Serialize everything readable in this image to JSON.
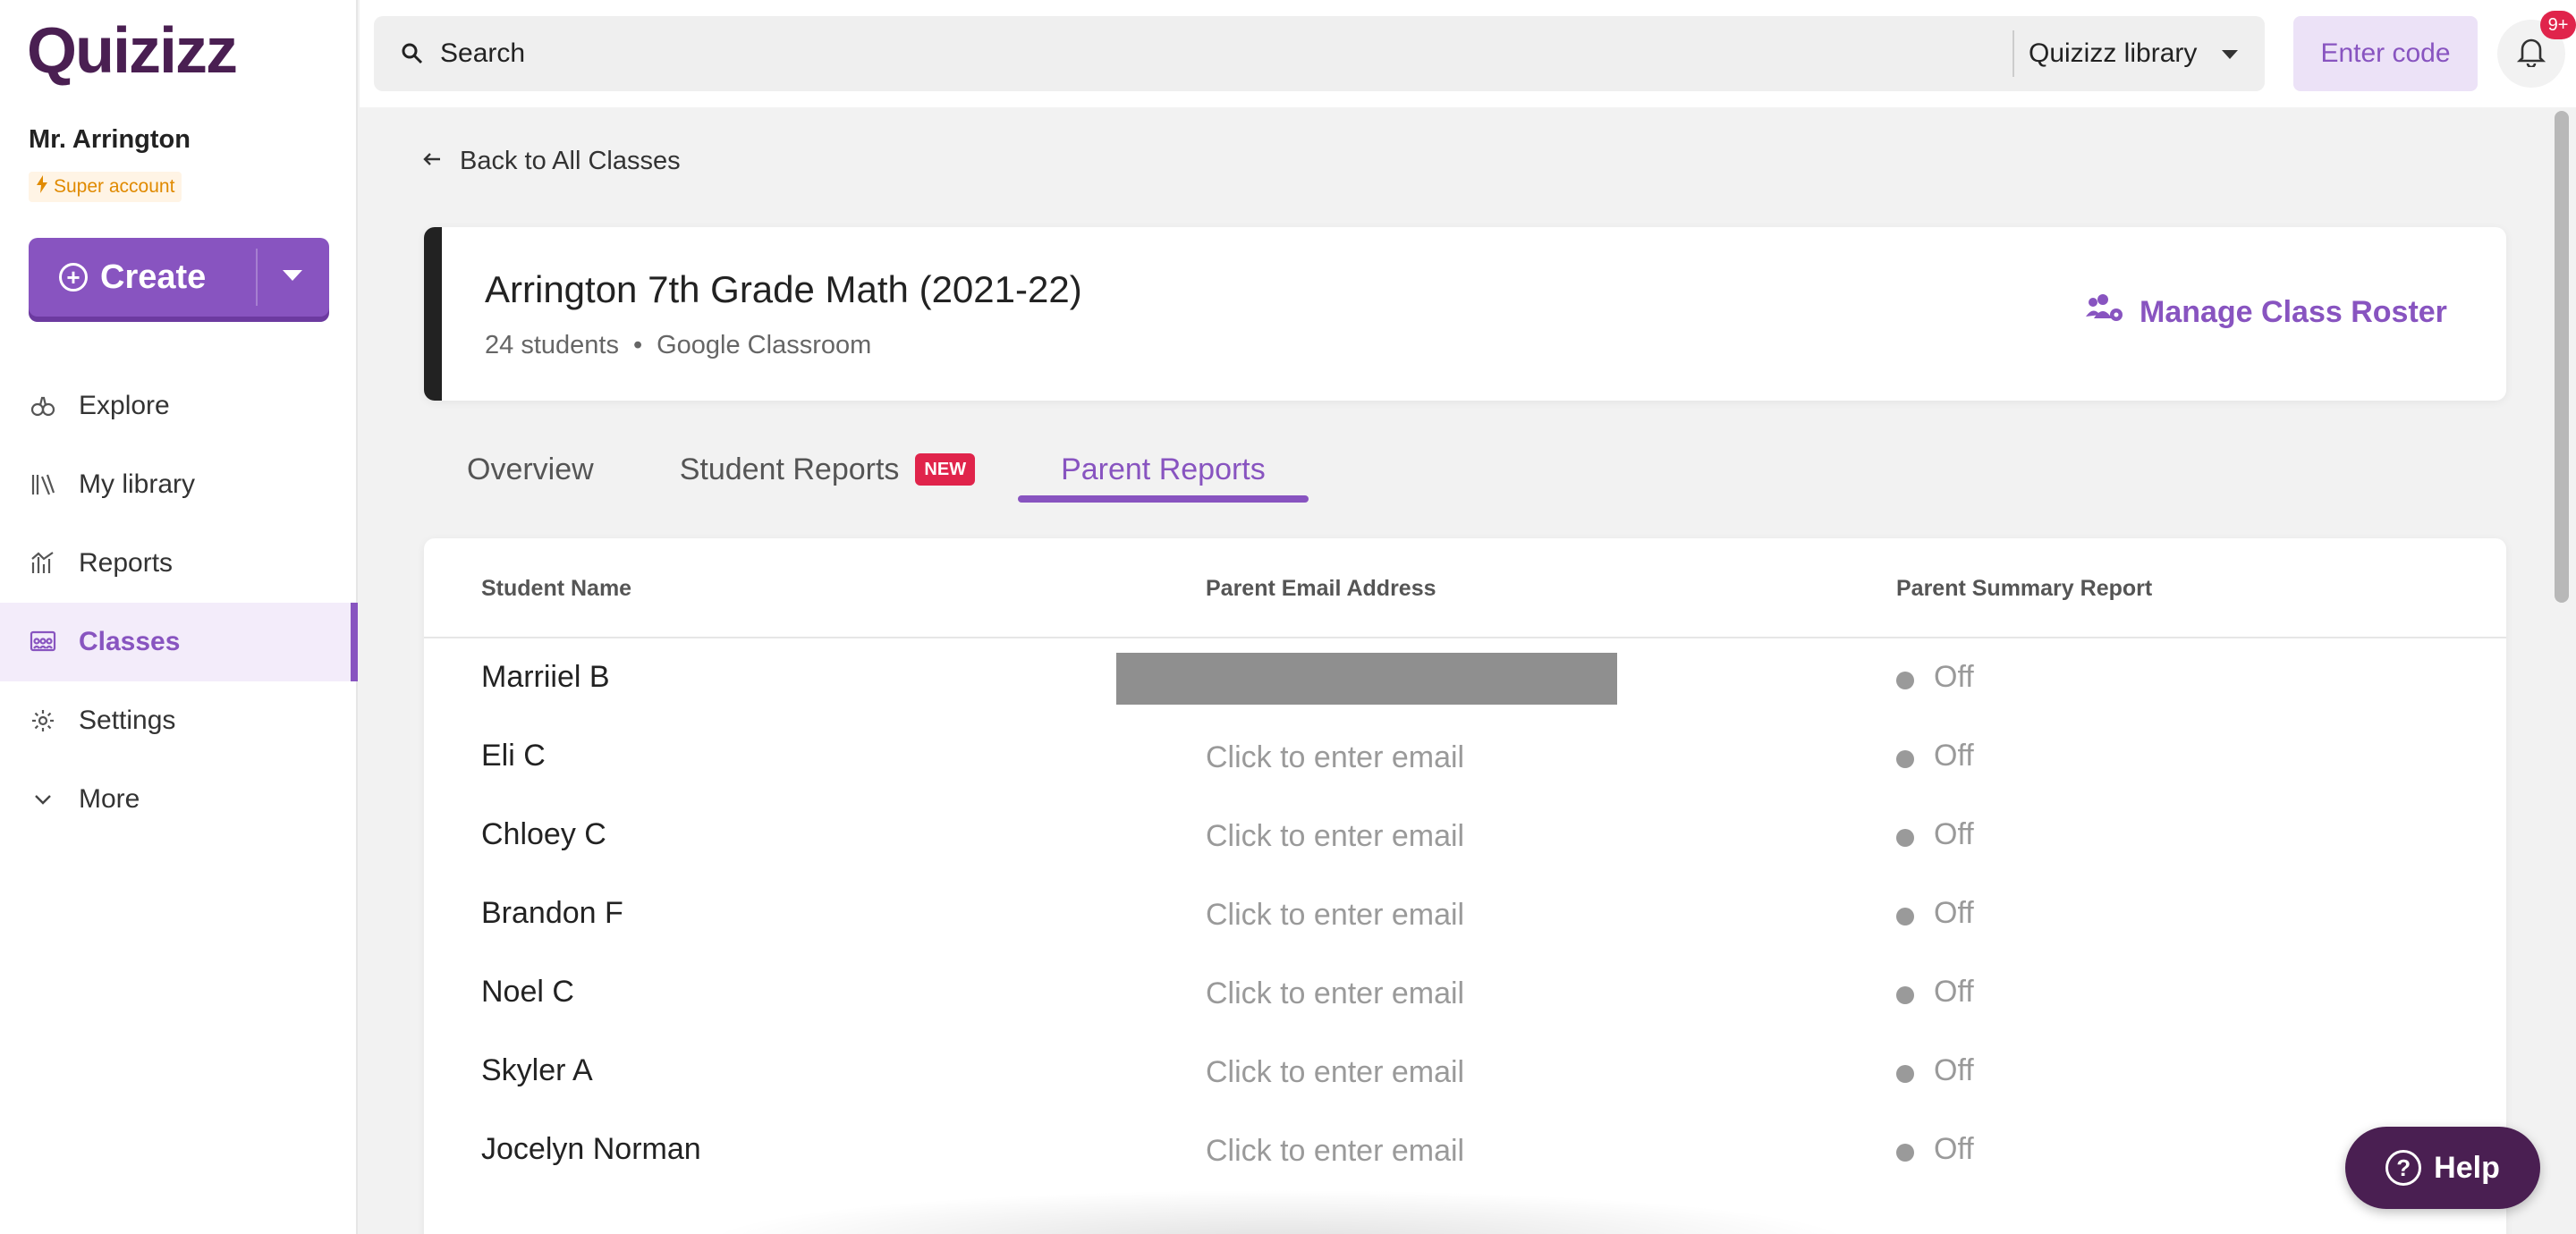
{
  "brand": {
    "logo_text": "Quizizz",
    "accent": "#8854c0",
    "dark": "#4a1f52"
  },
  "sidebar": {
    "teacher_name": "Mr. Arrington",
    "account_badge": "Super account",
    "create_label": "Create",
    "items": [
      {
        "label": "Explore",
        "icon": "explore-icon"
      },
      {
        "label": "My library",
        "icon": "library-icon"
      },
      {
        "label": "Reports",
        "icon": "reports-icon"
      },
      {
        "label": "Classes",
        "icon": "classes-icon",
        "active": true
      },
      {
        "label": "Settings",
        "icon": "gear-icon"
      },
      {
        "label": "More",
        "icon": "chevron-down-icon"
      }
    ]
  },
  "topbar": {
    "search_placeholder": "Search",
    "library_select": "Quizizz library",
    "enter_code": "Enter code",
    "notification_count": "9+"
  },
  "main": {
    "back_link": "Back to All Classes",
    "class": {
      "title": "Arrington 7th Grade Math (2021-22)",
      "students": "24 students",
      "separator": "•",
      "source": "Google Classroom",
      "manage_roster": "Manage Class Roster"
    },
    "tabs": [
      {
        "label": "Overview"
      },
      {
        "label": "Student Reports",
        "badge": "NEW"
      },
      {
        "label": "Parent Reports",
        "active": true
      }
    ],
    "table": {
      "headers": [
        "Student Name",
        "Parent Email Address",
        "Parent Summary Report"
      ],
      "rows": [
        {
          "name": "Marriiel B",
          "email": "",
          "redacted": true,
          "report": "Off"
        },
        {
          "name": "Eli C",
          "email": "Click to enter email",
          "report": "Off"
        },
        {
          "name": "Chloey C",
          "email": "Click to enter email",
          "report": "Off"
        },
        {
          "name": "Brandon F",
          "email": "Click to enter email",
          "report": "Off"
        },
        {
          "name": "Noel C",
          "email": "Click to enter email",
          "report": "Off"
        },
        {
          "name": "Skyler A",
          "email": "Click to enter email",
          "report": "Off"
        },
        {
          "name": "Jocelyn Norman",
          "email": "Click to enter email",
          "report": "Off"
        }
      ]
    }
  },
  "help": {
    "label": "Help"
  }
}
